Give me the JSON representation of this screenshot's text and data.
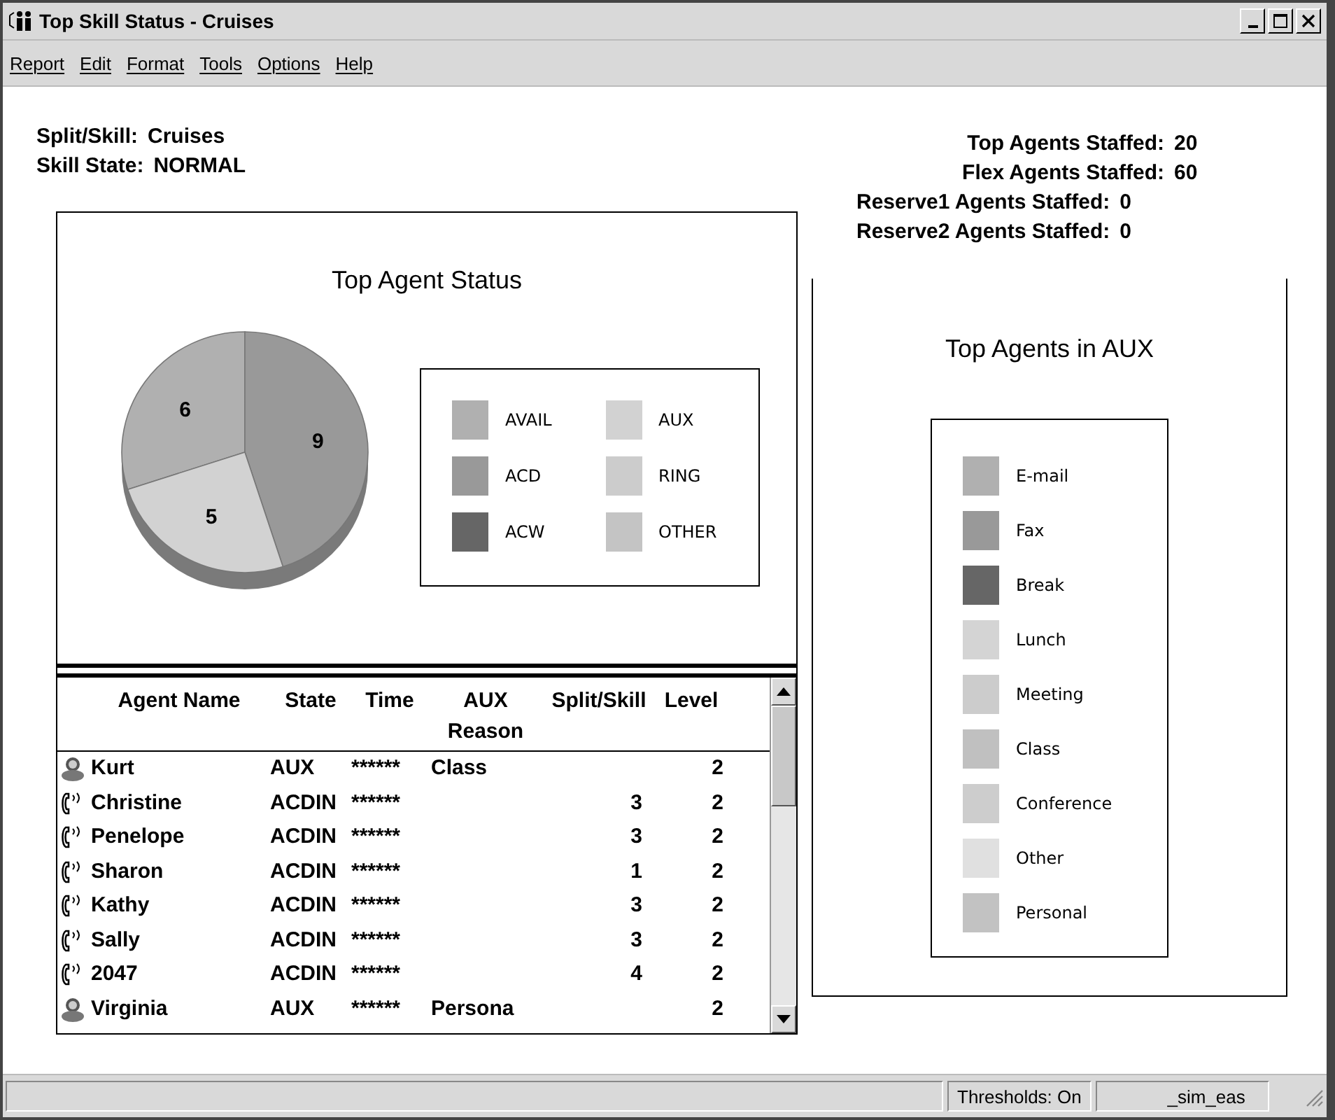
{
  "window": {
    "title": "Top Skill Status - Cruises"
  },
  "menu": [
    {
      "label": "Report"
    },
    {
      "label": "Edit"
    },
    {
      "label": "Format"
    },
    {
      "label": "Tools"
    },
    {
      "label": "Options"
    },
    {
      "label": "Help"
    }
  ],
  "skill_info": [
    {
      "label": "Split/Skill:",
      "value": "Cruises"
    },
    {
      "label": "Skill State:",
      "value": "NORMAL"
    }
  ],
  "staffing": [
    {
      "label": "Top Agents Staffed:",
      "value": "20"
    },
    {
      "label": "Flex Agents Staffed:",
      "value": "60"
    },
    {
      "label": "Reserve1 Agents Staffed:",
      "value": "0"
    },
    {
      "label": "Reserve2 Agents Staffed:",
      "value": "0"
    }
  ],
  "status_chart": {
    "legend": [
      {
        "color": "#b0b0b0"
      },
      {
        "color": "#999999"
      },
      {
        "color": "#666666"
      },
      {
        "color": "#d2d2d2"
      },
      {
        "color": "#cccccc"
      },
      {
        "color": "#c4c4c4"
      }
    ],
    "chart_data": {
      "type": "pie",
      "title": "Top Agent Status",
      "categories": [
        "AVAIL",
        "ACD",
        "ACW",
        "AUX",
        "RING",
        "OTHER"
      ],
      "values": [
        6,
        9,
        0,
        5,
        0,
        0
      ],
      "data_labels": true
    }
  },
  "aux_chart": {
    "title": "Top Agents in AUX",
    "legend": [
      {
        "label": "E-mail",
        "color": "#b0b0b0"
      },
      {
        "label": "Fax",
        "color": "#999999"
      },
      {
        "label": "Break",
        "color": "#666666"
      },
      {
        "label": "Lunch",
        "color": "#d4d4d4"
      },
      {
        "label": "Meeting",
        "color": "#cccccc"
      },
      {
        "label": "Class",
        "color": "#c0c0c0"
      },
      {
        "label": "Conference",
        "color": "#cdcdcd"
      },
      {
        "label": "Other",
        "color": "#e0e0e0"
      },
      {
        "label": "Personal",
        "color": "#c2c2c2"
      }
    ]
  },
  "table": {
    "columns": [
      "Agent Name",
      "State",
      "Time",
      "AUX Reason",
      "Split/Skill",
      "Level"
    ],
    "rows": [
      {
        "kind": "aux",
        "cells": [
          "Kurt",
          "AUX",
          "******",
          "Class",
          "",
          "2"
        ]
      },
      {
        "kind": "phone",
        "cells": [
          "Christine",
          "ACDIN",
          "******",
          "",
          "3",
          "2"
        ]
      },
      {
        "kind": "phone",
        "cells": [
          "Penelope",
          "ACDIN",
          "******",
          "",
          "3",
          "2"
        ]
      },
      {
        "kind": "phone",
        "cells": [
          "Sharon",
          "ACDIN",
          "******",
          "",
          "1",
          "2"
        ]
      },
      {
        "kind": "phone",
        "cells": [
          "Kathy",
          "ACDIN",
          "******",
          "",
          "3",
          "2"
        ]
      },
      {
        "kind": "phone",
        "cells": [
          "Sally",
          "ACDIN",
          "******",
          "",
          "3",
          "2"
        ]
      },
      {
        "kind": "phone",
        "cells": [
          "2047",
          "ACDIN",
          "******",
          "",
          "4",
          "2"
        ]
      },
      {
        "kind": "aux",
        "cells": [
          "Virginia",
          "AUX",
          "******",
          "Persona",
          "",
          "2"
        ]
      }
    ]
  },
  "status_bar": [
    "Thresholds: On",
    "_sim_eas"
  ]
}
